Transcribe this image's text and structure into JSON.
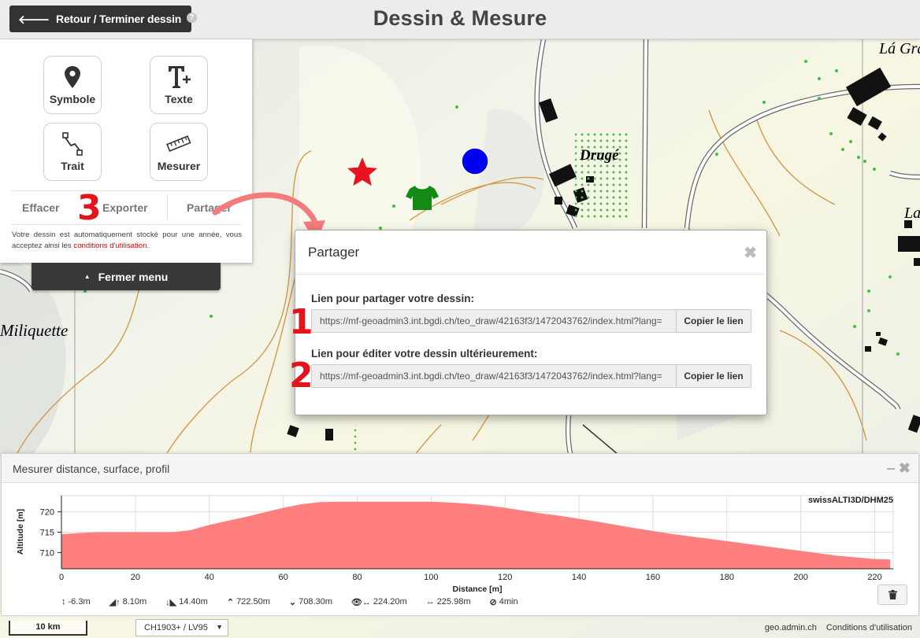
{
  "header": {
    "back_label": "Retour / Terminer dessin",
    "help_glyph": "?",
    "title": "Dessin & Mesure"
  },
  "map": {
    "place_names": [
      "Lá Gra",
      "Drugé",
      "La",
      "Miliquette"
    ],
    "colors": {
      "star": "#e8141d",
      "circle": "#0000ee",
      "shirt": "#138a13",
      "background": "#eef0e6",
      "contour": "#d29a4a",
      "building": "#111111",
      "vegetation": "#42c242"
    }
  },
  "panel": {
    "tools": [
      {
        "label": "Symbole",
        "icon": "map-marker-icon"
      },
      {
        "label": "Texte",
        "icon": "text-icon"
      },
      {
        "label": "Trait",
        "icon": "line-icon"
      },
      {
        "label": "Mesurer",
        "icon": "ruler-icon"
      }
    ],
    "actions": {
      "delete": "Effacer",
      "export": "Exporter",
      "share": "Partager"
    },
    "note_prefix": "Votre dessin est automatiquement stocké pour une année, vous acceptez ainsi les",
    "note_link": "conditions d'utilisation",
    "note_suffix": ".",
    "close_menu": "Fermer menu"
  },
  "annotations": [
    "1",
    "2",
    "3"
  ],
  "share_dialog": {
    "title": "Partager",
    "close_glyph": "✖",
    "share_label": "Lien pour partager votre dessin:",
    "share_url": "https://mf-geoadmin3.int.bgdi.ch/teo_draw/42163f3/1472043762/index.html?lang=",
    "edit_label": "Lien pour éditer votre dessin ultérieurement:",
    "edit_url": "https://mf-geoadmin3.int.bgdi.ch/teo_draw/42163f3/1472043762/index.html?lang=",
    "copy_label": "Copier le lien"
  },
  "measure": {
    "title": "Mesurer distance, surface, profil",
    "minimize_glyph": "‒",
    "close_glyph": "✖",
    "stats": [
      {
        "icon": "height-diff-icon",
        "symbol": "↕",
        "value": "-6.3m"
      },
      {
        "icon": "ascent-icon",
        "symbol": "◢↑",
        "value": "8.10m"
      },
      {
        "icon": "descent-icon",
        "symbol": "↓◣",
        "value": "14.40m"
      },
      {
        "icon": "highest-point-icon",
        "symbol": "⌃",
        "value": "722.50m"
      },
      {
        "icon": "lowest-point-icon",
        "symbol": "⌄",
        "value": "708.30m"
      },
      {
        "icon": "eye-distance-icon",
        "symbol": "👁↔",
        "value": "224.20m"
      },
      {
        "icon": "distance-icon",
        "symbol": "↔",
        "value": "225.98m"
      },
      {
        "icon": "clock-icon",
        "symbol": "⊘",
        "value": "4min"
      }
    ]
  },
  "chart_data": {
    "type": "area",
    "title": "swissALTI3D/DHM25",
    "xlabel": "Distance [m]",
    "ylabel": "Altitude [m]",
    "xlim": [
      0,
      225
    ],
    "ylim": [
      706,
      724
    ],
    "xticks": [
      0,
      20,
      40,
      60,
      80,
      100,
      120,
      140,
      160,
      180,
      200,
      220
    ],
    "yticks": [
      710,
      715,
      720
    ],
    "grid": true,
    "color": "#ff7f7f",
    "series": [
      {
        "x": [
          0,
          5,
          10,
          15,
          20,
          25,
          30,
          35,
          40,
          45,
          50,
          55,
          60,
          65,
          70,
          75,
          80,
          85,
          90,
          95,
          100,
          105,
          110,
          115,
          120,
          125,
          130,
          135,
          140,
          145,
          150,
          155,
          160,
          165,
          170,
          175,
          180,
          185,
          190,
          195,
          200,
          205,
          210,
          215,
          220,
          224.2
        ],
        "y": [
          714.5,
          714.8,
          715.0,
          715.0,
          715.0,
          715.0,
          715.0,
          715.5,
          716.8,
          717.8,
          718.8,
          719.9,
          721.0,
          721.9,
          722.4,
          722.5,
          722.5,
          722.5,
          722.5,
          722.5,
          722.5,
          722.3,
          722.0,
          721.6,
          721.0,
          720.3,
          719.6,
          719.0,
          718.3,
          717.6,
          716.8,
          716.0,
          715.3,
          714.6,
          714.0,
          713.4,
          712.8,
          712.2,
          711.6,
          711.0,
          710.4,
          709.8,
          709.2,
          708.8,
          708.4,
          708.3
        ]
      }
    ]
  },
  "footer": {
    "scale_label": "10 km",
    "crs_label": "CH1903+ / LV95",
    "crs_dropdown_glyph": "▼",
    "links": [
      "geo.admin.ch",
      "Conditions d'utilisation"
    ]
  }
}
